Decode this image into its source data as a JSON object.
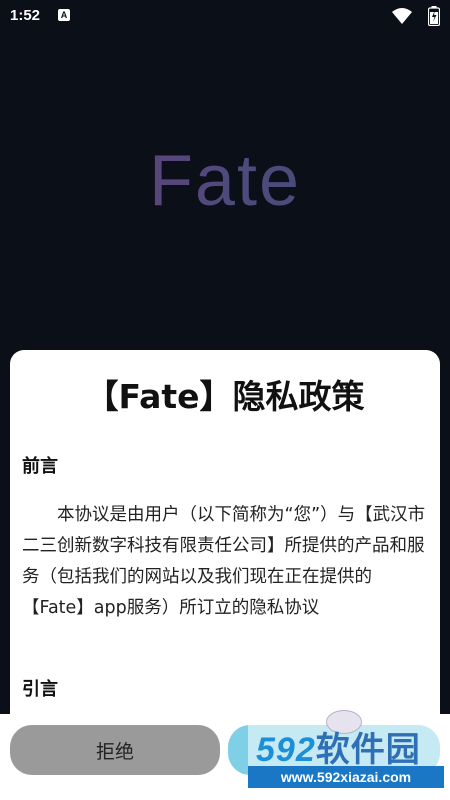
{
  "status_bar": {
    "time": "1:52",
    "notification_icon": "a-icon",
    "wifi_icon": "wifi-icon",
    "battery_icon": "battery-icon"
  },
  "splash": {
    "logo_text": "Fate"
  },
  "dialog": {
    "title": "【Fate】隐私政策",
    "sections": [
      {
        "heading": "前言",
        "body": "本协议是由用户（以下简称为“您”）与【武汉市二三创新数字科技有限责任公司】所提供的产品和服务（包括我们的网站以及我们现在正在提供的【Fate】app服务）所订立的隐私协议"
      },
      {
        "heading": "引言"
      }
    ]
  },
  "buttons": {
    "reject_label": "拒绝",
    "agree_label": ""
  },
  "watermark": {
    "brand_number": "592",
    "brand_text": "软件园",
    "url": "www.592xiazai.com"
  },
  "colors": {
    "background": "#0b0f18",
    "reject_button": "#9a9a9a",
    "agree_button": "#7fd0e6",
    "watermark_blue": "#1977c6"
  }
}
